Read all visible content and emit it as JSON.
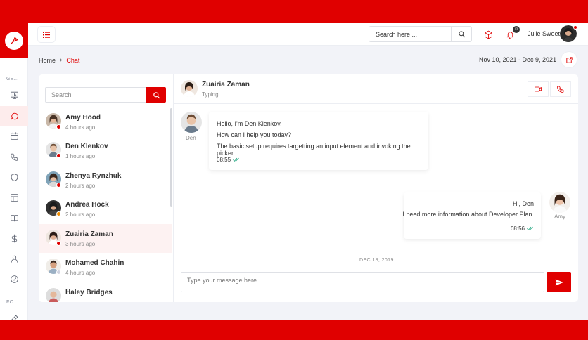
{
  "header": {
    "search_placeholder": "Search here ...",
    "notification_count": "0",
    "user_name": "Julie Sweet"
  },
  "sidebar": {
    "section1": "GE...",
    "section2": "FO...",
    "items": [
      "monitor-icon",
      "chat-icon",
      "calendar-icon",
      "phone-icon",
      "shield-icon",
      "layout-icon",
      "book-icon",
      "dollar-icon",
      "user-icon",
      "check-circle-icon",
      "edit-icon"
    ]
  },
  "breadcrumb": {
    "home": "Home",
    "current": "Chat"
  },
  "date_range": "Nov 10, 2021 - Dec 9, 2021",
  "contacts": {
    "search_placeholder": "Search",
    "list": [
      {
        "name": "Amy Hood",
        "time": "4 hours ago",
        "status_color": "#e00000"
      },
      {
        "name": "Den Klenkov",
        "time": "1 hours ago",
        "status_color": "#e00000"
      },
      {
        "name": "Zhenya Rynzhuk",
        "time": "2 hours ago",
        "status_color": "#e00000"
      },
      {
        "name": "Andrea Hock",
        "time": "2 hours ago",
        "status_color": "#f08c00"
      },
      {
        "name": "Zuairia Zaman",
        "time": "3 hours ago",
        "status_color": "#e00000"
      },
      {
        "name": "Mohamed Chahin",
        "time": "4 hours ago",
        "status_color": "#d0d3e0"
      },
      {
        "name": "Haley Bridges",
        "time": "",
        "status_color": "#e00000"
      }
    ]
  },
  "chat": {
    "name": "Zuairia Zaman",
    "status": "Typing ...",
    "incoming": {
      "sender": "Den",
      "lines": [
        "Hello, I'm Den Klenkov.",
        "How can I help you today?",
        "The basic setup requires targetting an input element and invoking the picker:"
      ],
      "time": "08:55"
    },
    "outgoing": {
      "sender": "Amy",
      "lines": [
        "Hi, Den",
        "I need more information about Developer Plan."
      ],
      "time": "08:56"
    },
    "divider": "DEC 18, 2019",
    "composer_placeholder": "Type your message here..."
  },
  "colors": {
    "accent": "#e00000",
    "background": "#f2f3f8"
  }
}
